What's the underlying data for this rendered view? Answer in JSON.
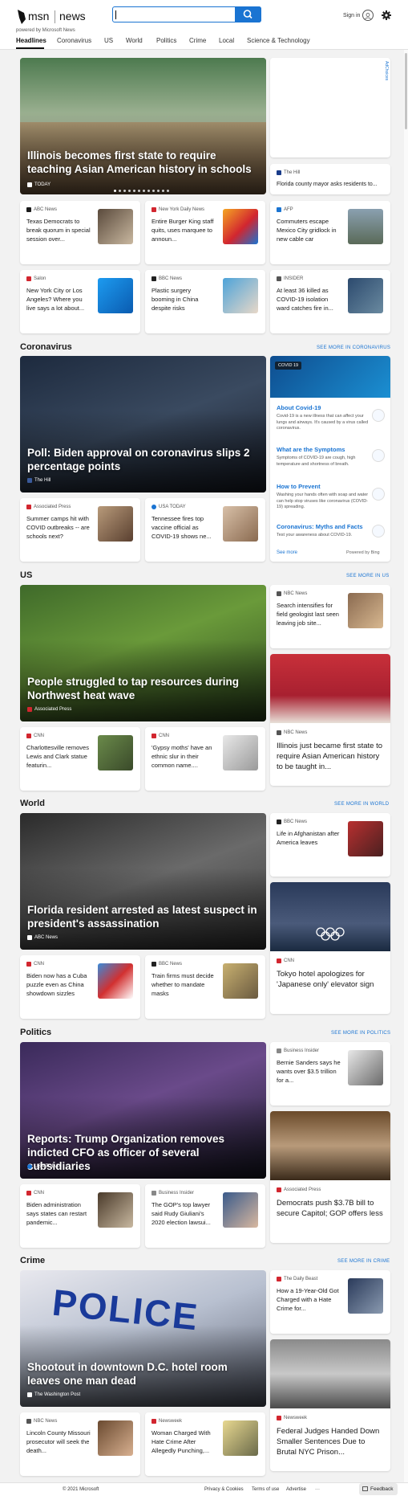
{
  "header": {
    "brand_msn": "msn",
    "brand_news": "news",
    "brand_sub": "powered by Microsoft News",
    "search_value": "",
    "signin": "Sign in"
  },
  "nav": {
    "tabs": [
      "Headlines",
      "Coronavirus",
      "US",
      "World",
      "Politics",
      "Crime",
      "Local",
      "Science & Technology"
    ]
  },
  "adchoices": "AdChoices",
  "headlines": {
    "hero": {
      "title": "Illinois becomes first state to require teaching Asian American history in schools",
      "source": "TODAY"
    },
    "side_card": {
      "source": "The Hill",
      "title": "Florida county mayor asks residents to..."
    },
    "cards": [
      {
        "source": "ABC News",
        "title": "Texas Democrats to break quorum in special session over...",
        "color": "#1a1a1a"
      },
      {
        "source": "New York Daily News",
        "title": "Entire Burger King staff quits, uses marquee to announ...",
        "color": "#d2262f"
      },
      {
        "source": "AFP",
        "title": "Commuters escape Mexico City gridlock in new cable car",
        "color": "#1a74d2"
      },
      {
        "source": "Salon",
        "title": "New York City or Los Angeles? Where you live says a lot about...",
        "color": "#d2262f"
      },
      {
        "source": "BBC News",
        "title": "Plastic surgery booming in China despite risks",
        "color": "#222"
      },
      {
        "source": "INSIDER",
        "title": "At least 36 killed as COVID-19 isolation ward catches fire in...",
        "color": "#555"
      }
    ]
  },
  "coronavirus": {
    "heading": "Coronavirus",
    "see_more": "SEE MORE IN CORONAVIRUS",
    "hero": {
      "title": "Poll: Biden approval on coronavirus slips 2 percentage points",
      "source": "The Hill"
    },
    "covid_badge": "COVID 19",
    "covid_items": [
      {
        "h": "About Covid-19",
        "d": "Covid-19 is a new illness that can affect your lungs and airways. It's caused by a virus called coronavirus."
      },
      {
        "h": "What are the Symptoms",
        "d": "Symptoms of COVID-19 are cough, high temperature and shortness of breath."
      },
      {
        "h": "How to Prevent",
        "d": "Washing your hands often with soap and water can help stop viruses like coronavirus (COVID-19) spreading."
      },
      {
        "h": "Coronavirus: Myths and Facts",
        "d": "Test your awareness about COVID-19."
      }
    ],
    "covid_see_more": "See more",
    "covid_powered": "Powered by Bing",
    "cards": [
      {
        "source": "Associated Press",
        "title": "Summer camps hit with COVID outbreaks -- are schools next?",
        "color": "#d2262f"
      },
      {
        "source": "USA TODAY",
        "title": "Tennessee fires top vaccine official as COVID-19 shows ne...",
        "color": "#1a74d2"
      }
    ]
  },
  "us": {
    "heading": "US",
    "see_more": "SEE MORE IN US",
    "hero": {
      "title": "People struggled to tap resources during Northwest heat wave",
      "source": "Associated Press"
    },
    "side_card": {
      "source": "NBC News",
      "title": "Search intensifies for field geologist last seen leaving job site..."
    },
    "tall": {
      "source": "NBC News",
      "title": "Illinois just became first state to require Asian American history to be taught in..."
    },
    "cards": [
      {
        "source": "CNN",
        "title": "Charlottesville removes Lewis and Clark statue featurin...",
        "color": "#d2262f"
      },
      {
        "source": "CNN",
        "title": "'Gypsy moths' have an ethnic slur in their common name....",
        "color": "#d2262f"
      }
    ]
  },
  "world": {
    "heading": "World",
    "see_more": "SEE MORE IN WORLD",
    "hero": {
      "title": "Florida resident arrested as latest suspect in president's assassination",
      "source": "ABC News"
    },
    "side_card": {
      "source": "BBC News",
      "title": "Life in Afghanistan after America leaves"
    },
    "tall": {
      "source": "CNN",
      "title": "Tokyo hotel apologizes for 'Japanese only' elevator sign"
    },
    "cards": [
      {
        "source": "CNN",
        "title": "Biden now has a Cuba puzzle even as China showdown sizzles",
        "color": "#d2262f"
      },
      {
        "source": "BBC News",
        "title": "Train firms must decide whether to mandate masks",
        "color": "#222"
      }
    ]
  },
  "politics": {
    "heading": "Politics",
    "see_more": "SEE MORE IN POLITICS",
    "hero": {
      "title": "Reports: Trump Organization removes indicted CFO as officer of several subsidiaries",
      "source": "USA TODAY"
    },
    "side_card": {
      "source": "Business Insider",
      "title": "Bernie Sanders says he wants over $3.5 trillion for a..."
    },
    "tall": {
      "source": "Associated Press",
      "title": "Democrats push $3.7B bill to secure Capitol; GOP offers less"
    },
    "cards": [
      {
        "source": "CNN",
        "title": "Biden administration says states can restart pandemic...",
        "color": "#d2262f"
      },
      {
        "source": "Business Insider",
        "title": "The GOP's top lawyer said Rudy Giuliani's 2020 election lawsui...",
        "color": "#888"
      }
    ]
  },
  "crime": {
    "heading": "Crime",
    "see_more": "SEE MORE IN CRIME",
    "hero": {
      "title": "Shootout in downtown D.C. hotel room leaves one man dead",
      "source": "The Washington Post"
    },
    "side_card": {
      "source": "The Daily Beast",
      "title": "How a 19-Year-Old Got Charged with a Hate Crime for..."
    },
    "tall": {
      "source": "Newsweek",
      "title": "Federal Judges Handed Down Smaller Sentences Due to Brutal NYC Prison..."
    },
    "cards": [
      {
        "source": "NBC News",
        "title": "Lincoln County Missouri prosecutor will seek the death...",
        "color": "#555"
      },
      {
        "source": "Newsweek",
        "title": "Woman Charged With Hate Crime After Allegedly Punching,...",
        "color": "#d2262f"
      }
    ]
  },
  "footer": {
    "copyright": "© 2021 Microsoft",
    "privacy": "Privacy & Cookies",
    "terms": "Terms of use",
    "advertise": "Advertise",
    "more": "···",
    "feedback": "Feedback"
  }
}
